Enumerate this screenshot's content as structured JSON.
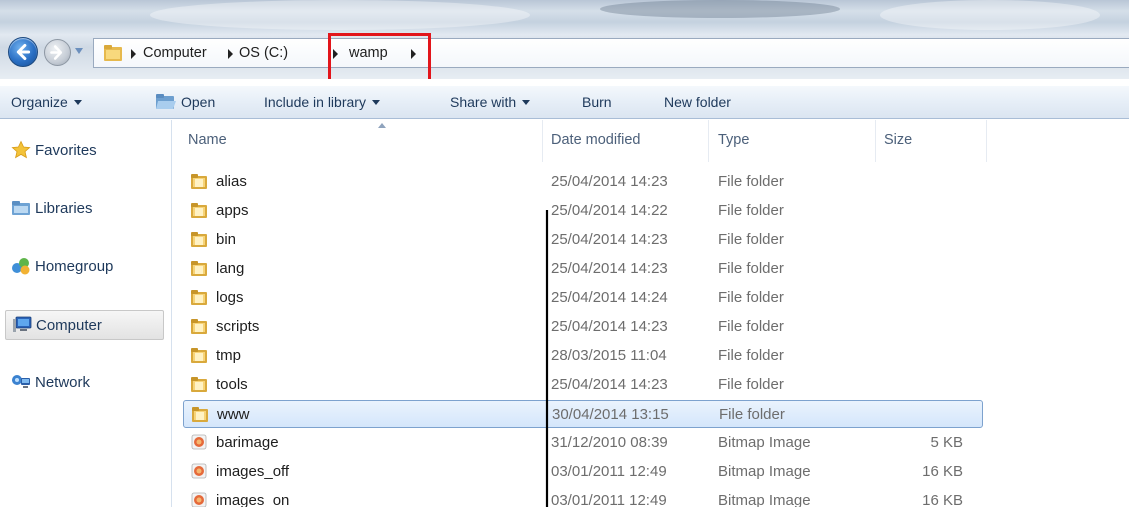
{
  "address_bar": {
    "breadcrumbs": [
      "Computer",
      "OS (C:)",
      "wamp"
    ],
    "icons": {
      "back": "back-arrow-icon",
      "forward": "forward-arrow-icon",
      "folder": "folder-icon"
    }
  },
  "toolbar": {
    "organize": "Organize",
    "open": "Open",
    "include_in_library": "Include in library",
    "share_with": "Share with",
    "burn": "Burn",
    "new_folder": "New folder"
  },
  "navigation": {
    "items": [
      {
        "label": "Favorites",
        "icon": "star-icon"
      },
      {
        "label": "Libraries",
        "icon": "library-icon"
      },
      {
        "label": "Homegroup",
        "icon": "homegroup-icon"
      },
      {
        "label": "Computer",
        "icon": "computer-icon",
        "selected": true
      },
      {
        "label": "Network",
        "icon": "network-icon"
      }
    ]
  },
  "file_list": {
    "columns": {
      "name": "Name",
      "date": "Date modified",
      "type": "Type",
      "size": "Size"
    },
    "rows": [
      {
        "name": "alias",
        "date": "25/04/2014 14:23",
        "type": "File folder",
        "size": "",
        "icon": "folder-icon"
      },
      {
        "name": "apps",
        "date": "25/04/2014 14:22",
        "type": "File folder",
        "size": "",
        "icon": "folder-icon"
      },
      {
        "name": "bin",
        "date": "25/04/2014 14:23",
        "type": "File folder",
        "size": "",
        "icon": "folder-icon"
      },
      {
        "name": "lang",
        "date": "25/04/2014 14:23",
        "type": "File folder",
        "size": "",
        "icon": "folder-icon"
      },
      {
        "name": "logs",
        "date": "25/04/2014 14:24",
        "type": "File folder",
        "size": "",
        "icon": "folder-icon"
      },
      {
        "name": "scripts",
        "date": "25/04/2014 14:23",
        "type": "File folder",
        "size": "",
        "icon": "folder-icon"
      },
      {
        "name": "tmp",
        "date": "28/03/2015 11:04",
        "type": "File folder",
        "size": "",
        "icon": "folder-icon"
      },
      {
        "name": "tools",
        "date": "25/04/2014 14:23",
        "type": "File folder",
        "size": "",
        "icon": "folder-icon"
      },
      {
        "name": "www",
        "date": "30/04/2014 13:15",
        "type": "File folder",
        "size": "",
        "icon": "folder-icon",
        "selected": true
      },
      {
        "name": "barimage",
        "date": "31/12/2010 08:39",
        "type": "Bitmap Image",
        "size": "5 KB",
        "icon": "bitmap-icon"
      },
      {
        "name": "images_off",
        "date": "03/01/2011 12:49",
        "type": "Bitmap Image",
        "size": "16 KB",
        "icon": "bitmap-icon"
      },
      {
        "name": "images_on",
        "date": "03/01/2011 12:49",
        "type": "Bitmap Image",
        "size": "16 KB",
        "icon": "bitmap-icon"
      }
    ]
  },
  "colors": {
    "highlight_box": "#e2151b",
    "selection": "#d4e6fb",
    "text": "#1e395b"
  }
}
